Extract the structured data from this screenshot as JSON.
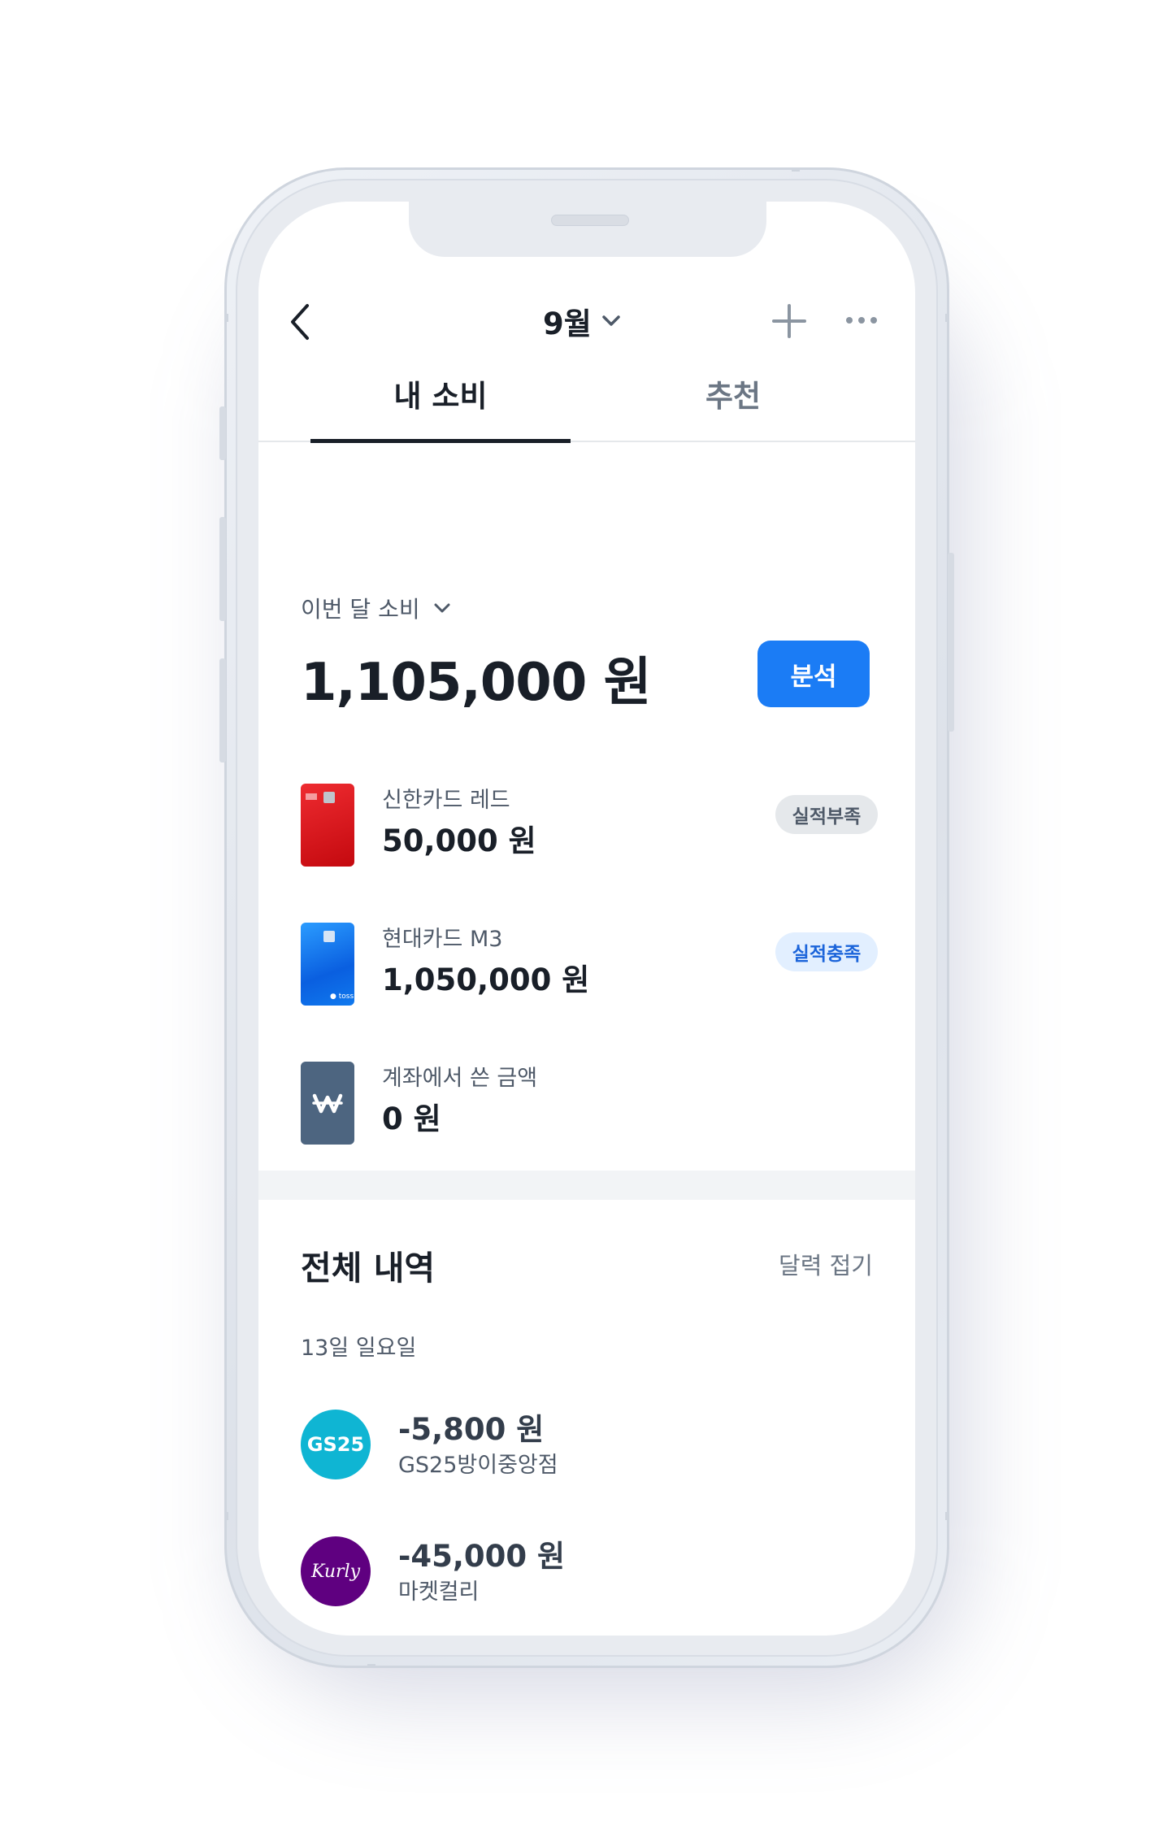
{
  "header": {
    "month": "9월"
  },
  "tabs": [
    {
      "label": "내 소비",
      "active": true
    },
    {
      "label": "추천",
      "active": false
    }
  ],
  "summary": {
    "period_label": "이번 달 소비",
    "total": "1,105,000 원",
    "analyze_label": "분석"
  },
  "spending": [
    {
      "name": "신한카드 레드",
      "amount": "50,000 원",
      "badge": "실적부족",
      "thumb": "red-card"
    },
    {
      "name": "현대카드 M3",
      "amount": "1,050,000 원",
      "badge": "실적충족",
      "thumb": "blue-card"
    },
    {
      "name": "계좌에서 쓴 금액",
      "amount": "0 원",
      "thumb": "won-icon"
    }
  ],
  "history": {
    "title": "전체 내역",
    "calendar_toggle": "달력 접기",
    "date": "13일 일요일",
    "transactions": [
      {
        "amount": "-5,800 원",
        "merchant": "GS25방이중앙점",
        "logo_text": "GS25",
        "logo_color": "#0fb5d3"
      },
      {
        "amount": "-45,000 원",
        "merchant": "마켓컬리",
        "logo_text": "Kurly",
        "logo_color": "#5f0080"
      }
    ]
  },
  "colors": {
    "accent": "#1b7cf5",
    "badge_positive_bg": "#e2efff",
    "badge_positive_text": "#1b64da",
    "badge_neutral_bg": "#e5e8eb"
  }
}
